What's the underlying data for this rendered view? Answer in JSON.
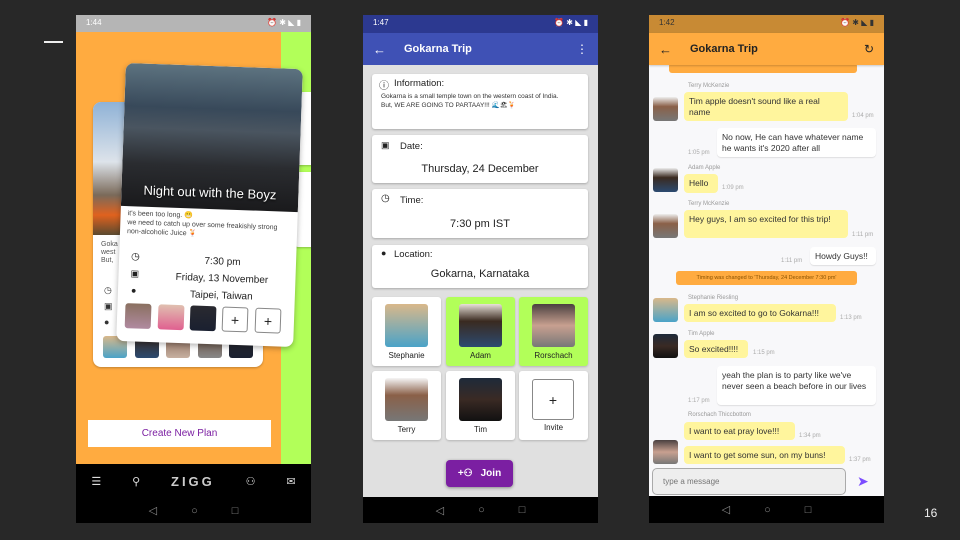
{
  "slide": {
    "page_number": "16"
  },
  "colors": {
    "orange": "#ffab40",
    "green": "#b2ff59",
    "indigo": "#3f51b5",
    "purple": "#7b1fa2",
    "bubble_yellow": "#fff59d"
  },
  "phone1": {
    "time": "1:44",
    "front_card": {
      "title": "Night out with the Boyz",
      "description": "it's been too long. 😬\nwe need to catch up over some freakishly strong non-alcoholic Juice 🍹",
      "time": "7:30 pm",
      "date": "Friday, 13 November",
      "location": "Taipei, Taiwan"
    },
    "back_card": {
      "text_lines": [
        "Goka",
        "west",
        "But, "
      ]
    },
    "create_button": "Create New Plan",
    "bottom_nav": {
      "logo": "ZIGG",
      "icons": [
        "tune-icon",
        "search-icon",
        "people-icon",
        "mail-icon"
      ]
    }
  },
  "phone2": {
    "time": "1:47",
    "title": "Gokarna Trip",
    "information": {
      "label": "Information:",
      "text": "Gokarna is a small temple town on the western coast of India.\nBut, WE ARE GOING TO PARTAAY!!! 🌊🏖🍹"
    },
    "date": {
      "label": "Date:",
      "value": "Thursday, 24 December"
    },
    "time_info": {
      "label": "Time:",
      "value": "7:30 pm IST"
    },
    "location": {
      "label": "Location:",
      "value": "Gokarna, Karnataka"
    },
    "members": [
      {
        "name": "Stephanie",
        "highlighted": false
      },
      {
        "name": "Adam",
        "highlighted": true
      },
      {
        "name": "Rorschach",
        "highlighted": true
      },
      {
        "name": "Terry",
        "highlighted": false
      },
      {
        "name": "Tim",
        "highlighted": false
      }
    ],
    "invite_label": "Invite",
    "join_label": "Join"
  },
  "phone3": {
    "time": "1:42",
    "title": "Gokarna Trip",
    "messages": [
      {
        "sender": "Terry McKenzie",
        "text": "Tim apple doesn't sound like a real name",
        "time": "1:04 pm"
      },
      {
        "sender": "",
        "text": "No now, He can have whatever name he wants it's 2020 after all",
        "time": "1:05 pm"
      },
      {
        "sender": "Adam Apple",
        "text": "Hello",
        "time": "1:09 pm"
      },
      {
        "sender": "Terry McKenzie",
        "text": "Hey guys, I am so excited for this trip!",
        "time": "1:11 pm"
      },
      {
        "sender": "",
        "text": "Howdy Guys!!",
        "time": "1:11 pm"
      },
      {
        "sender": "Stephanie Riesling",
        "text": "I am so excited to go to Gokarna!!!",
        "time": "1:13 pm"
      },
      {
        "sender": "Tim Apple",
        "text": "So excited!!!!",
        "time": "1:15 pm"
      },
      {
        "sender": "",
        "text": "yeah the plan is to party like we've never seen a beach before in our lives",
        "time": "1:17 pm"
      },
      {
        "sender": "Rorschach Thiccbottom",
        "text": "I want to eat pray love!!!",
        "time": "1:34 pm"
      },
      {
        "sender": "",
        "text": "I want to get some sun, on my buns!",
        "time": "1:37 pm"
      }
    ],
    "notice": "Timing was changed to 'Thursday, 24 December 7:30 pm'",
    "input_placeholder": "type a message"
  }
}
